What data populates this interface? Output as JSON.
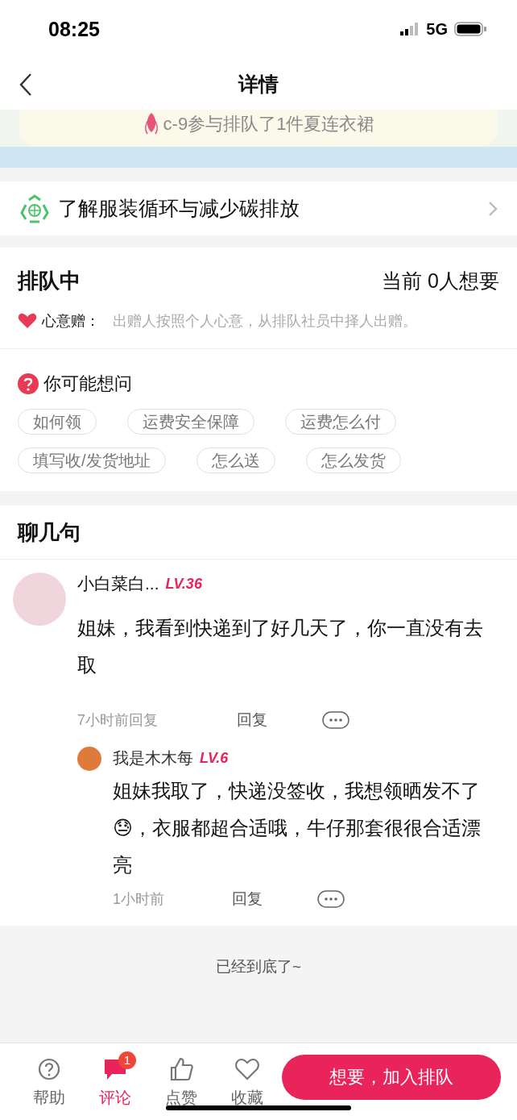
{
  "status_bar": {
    "time": "08:25",
    "network": "5G"
  },
  "nav": {
    "title": "详情"
  },
  "banner": {
    "text": "c-9参与排队了1件夏连衣裙"
  },
  "eco_link": {
    "label": "了解服装循环与减少碳排放"
  },
  "queue": {
    "title": "排队中",
    "count": "当前 0人想要",
    "mode_label": "心意赠：",
    "mode_desc": "出赠人按照个人心意，从排队社员中择人出赠。"
  },
  "faq": {
    "title": "你可能想问",
    "chips": [
      [
        "如何领",
        "运费安全保障",
        "运费怎么付"
      ],
      [
        "填写收/发货地址",
        "怎么送",
        "怎么发货"
      ]
    ]
  },
  "comments": {
    "title": "聊几句",
    "items": [
      {
        "name": "小白菜白...",
        "level": "LV.36",
        "text": "姐妹，我看到快递到了好几天了，你一直没有去取",
        "time": "7小时前回复",
        "reply": "回复",
        "replies": [
          {
            "name": "我是木木每",
            "level": "LV.6",
            "text": "姐妹我取了，快递没签收，我想领晒发不了😓，衣服都超合适哦，牛仔那套很很合适漂亮",
            "time": "1小时前",
            "reply": "回复"
          }
        ]
      }
    ]
  },
  "end_text": "已经到底了~",
  "tab_bar": {
    "items": [
      {
        "kind": "help",
        "label": "帮助",
        "selected": false
      },
      {
        "kind": "comment",
        "label": "评论",
        "selected": true,
        "badge": "1"
      },
      {
        "kind": "like",
        "label": "点赞",
        "selected": false
      },
      {
        "kind": "favorite",
        "label": "收藏",
        "selected": false
      }
    ],
    "action": "想要，加入排队"
  }
}
